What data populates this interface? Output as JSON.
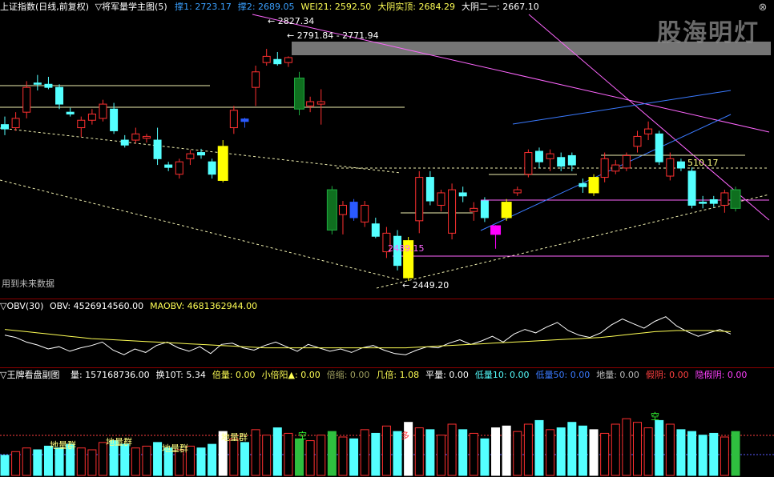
{
  "main": {
    "index_name": "上证指数(日线,前复权)",
    "indicator_name": "▽将军量学主图(5)",
    "items": [
      {
        "label": "撑1:",
        "value": "2723.17",
        "color": "#3aa0ff"
      },
      {
        "label": "撑2:",
        "value": "2689.05",
        "color": "#3aa0ff"
      },
      {
        "label": "WEI21:",
        "value": "2592.50",
        "color": "#ffff55"
      },
      {
        "label": "大阴实顶:",
        "value": "2684.29",
        "color": "#ffff55"
      },
      {
        "label": "大阴二一:",
        "value": "2667.10",
        "color": "#ffffff"
      }
    ],
    "annotations": {
      "high_label": "2827.34",
      "range_label": "2791.84 - 2771.94",
      "low_label": "2449.20",
      "mid_label": "2489.15",
      "right_label": "510.17",
      "note": "用到未来数据"
    },
    "watermark": "股海明灯"
  },
  "obv": {
    "title": "▽OBV(30)",
    "items": [
      {
        "label": "OBV:",
        "value": "4526914560.00",
        "color": "#ffffff"
      },
      {
        "label": "MAOBV:",
        "value": "4681362944.00",
        "color": "#ffff55"
      }
    ]
  },
  "volume": {
    "title": "▽王牌看盘副图",
    "items": [
      {
        "label": "量:",
        "value": "157168736.00",
        "color": "#ffffff"
      },
      {
        "label": "换10T:",
        "value": "5.34",
        "color": "#ffffff"
      },
      {
        "label": "倍量:",
        "value": "0.00",
        "color": "#ffff55"
      },
      {
        "label": "小倍阳▲:",
        "value": "0.00",
        "color": "#ffff55"
      },
      {
        "label": "倍缩:",
        "value": "0.00",
        "color": "#a0a060"
      },
      {
        "label": "几倍:",
        "value": "1.08",
        "color": "#ffff55"
      },
      {
        "label": "平量:",
        "value": "0.00",
        "color": "#ffffff"
      },
      {
        "label": "低量10:",
        "value": "0.00",
        "color": "#55ffff"
      },
      {
        "label": "低量50:",
        "value": "0.00",
        "color": "#3a7aff"
      },
      {
        "label": "地量:",
        "value": "0.00",
        "color": "#bbbbbb"
      },
      {
        "label": "假阴:",
        "value": "0.00",
        "color": "#ff4040"
      },
      {
        "label": "隐假阴:",
        "value": "0.00",
        "color": "#ff40ff"
      }
    ],
    "tags": [
      "地量群",
      "地量群",
      "地量群",
      "地量群",
      "空",
      "空",
      "多"
    ]
  },
  "chart_data": [
    {
      "type": "candlestick",
      "colors": {
        "up": "#ff3030",
        "down": "#54ffff",
        "highlight_yellow": "#ffff00",
        "highlight_magenta": "#ff00ff",
        "dark_green": "#0f6f1f",
        "blue": "#2a5aff"
      },
      "candles": [
        {
          "o": 2705,
          "h": 2718,
          "l": 2688,
          "c": 2698,
          "k": "down"
        },
        {
          "o": 2700,
          "h": 2725,
          "l": 2695,
          "c": 2715,
          "k": "up"
        },
        {
          "o": 2725,
          "h": 2775,
          "l": 2715,
          "c": 2765,
          "k": "up"
        },
        {
          "o": 2770,
          "h": 2785,
          "l": 2760,
          "c": 2772,
          "k": "down"
        },
        {
          "o": 2770,
          "h": 2782,
          "l": 2762,
          "c": 2765,
          "k": "down"
        },
        {
          "o": 2765,
          "h": 2770,
          "l": 2730,
          "c": 2738,
          "k": "down"
        },
        {
          "o": 2725,
          "h": 2732,
          "l": 2718,
          "c": 2722,
          "k": "down"
        },
        {
          "o": 2700,
          "h": 2718,
          "l": 2685,
          "c": 2712,
          "k": "up"
        },
        {
          "o": 2712,
          "h": 2730,
          "l": 2705,
          "c": 2722,
          "k": "up"
        },
        {
          "o": 2715,
          "h": 2745,
          "l": 2710,
          "c": 2738,
          "k": "up"
        },
        {
          "o": 2730,
          "h": 2740,
          "l": 2690,
          "c": 2695,
          "k": "down"
        },
        {
          "o": 2680,
          "h": 2688,
          "l": 2668,
          "c": 2672,
          "k": "down"
        },
        {
          "o": 2680,
          "h": 2700,
          "l": 2675,
          "c": 2690,
          "k": "up"
        },
        {
          "o": 2683,
          "h": 2690,
          "l": 2676,
          "c": 2686,
          "k": "up"
        },
        {
          "o": 2680,
          "h": 2700,
          "l": 2640,
          "c": 2650,
          "k": "down"
        },
        {
          "o": 2640,
          "h": 2645,
          "l": 2630,
          "c": 2636,
          "k": "down"
        },
        {
          "o": 2625,
          "h": 2650,
          "l": 2618,
          "c": 2645,
          "k": "up"
        },
        {
          "o": 2650,
          "h": 2664,
          "l": 2640,
          "c": 2658,
          "k": "up"
        },
        {
          "o": 2660,
          "h": 2666,
          "l": 2650,
          "c": 2656,
          "k": "down"
        },
        {
          "o": 2645,
          "h": 2650,
          "l": 2618,
          "c": 2625,
          "k": "down"
        },
        {
          "o": 2615,
          "h": 2680,
          "l": 2612,
          "c": 2670,
          "k": "yellow"
        },
        {
          "o": 2700,
          "h": 2735,
          "l": 2690,
          "c": 2728,
          "k": "up"
        },
        {
          "o": 2710,
          "h": 2716,
          "l": 2700,
          "c": 2714,
          "k": "blue"
        },
        {
          "o": 2765,
          "h": 2800,
          "l": 2735,
          "c": 2790,
          "k": "up"
        },
        {
          "o": 2805,
          "h": 2827,
          "l": 2800,
          "c": 2815,
          "k": "up"
        },
        {
          "o": 2810,
          "h": 2822,
          "l": 2800,
          "c": 2803,
          "k": "down"
        },
        {
          "o": 2805,
          "h": 2815,
          "l": 2798,
          "c": 2813,
          "k": "up"
        },
        {
          "o": 2780,
          "h": 2790,
          "l": 2720,
          "c": 2730,
          "k": "green"
        },
        {
          "o": 2735,
          "h": 2750,
          "l": 2725,
          "c": 2742,
          "k": "up"
        },
        {
          "o": 2742,
          "h": 2762,
          "l": 2705,
          "c": 2738,
          "k": "up"
        },
        {
          "o": 2600,
          "h": 2606,
          "l": 2528,
          "c": 2535,
          "k": "green"
        },
        {
          "o": 2560,
          "h": 2582,
          "l": 2528,
          "c": 2575,
          "k": "up"
        },
        {
          "o": 2580,
          "h": 2585,
          "l": 2550,
          "c": 2555,
          "k": "blue"
        },
        {
          "o": 2575,
          "h": 2582,
          "l": 2540,
          "c": 2548,
          "k": "up"
        },
        {
          "o": 2545,
          "h": 2555,
          "l": 2522,
          "c": 2525,
          "k": "down"
        },
        {
          "o": 2500,
          "h": 2540,
          "l": 2490,
          "c": 2530,
          "k": "up"
        },
        {
          "o": 2525,
          "h": 2535,
          "l": 2470,
          "c": 2478,
          "k": "down"
        },
        {
          "o": 2518,
          "h": 2524,
          "l": 2453,
          "c": 2458,
          "k": "yellow"
        },
        {
          "o": 2550,
          "h": 2630,
          "l": 2530,
          "c": 2620,
          "k": "up"
        },
        {
          "o": 2620,
          "h": 2630,
          "l": 2575,
          "c": 2582,
          "k": "down"
        },
        {
          "o": 2575,
          "h": 2600,
          "l": 2565,
          "c": 2595,
          "k": "up"
        },
        {
          "o": 2600,
          "h": 2610,
          "l": 2520,
          "c": 2530,
          "k": "up"
        },
        {
          "o": 2590,
          "h": 2605,
          "l": 2580,
          "c": 2595,
          "k": "down"
        },
        {
          "o": 2570,
          "h": 2580,
          "l": 2550,
          "c": 2565,
          "k": "up"
        },
        {
          "o": 2582,
          "h": 2588,
          "l": 2548,
          "c": 2555,
          "k": "down"
        },
        {
          "o": 2528,
          "h": 2543,
          "l": 2505,
          "c": 2542,
          "k": "magenta"
        },
        {
          "o": 2555,
          "h": 2585,
          "l": 2550,
          "c": 2580,
          "k": "yellow"
        },
        {
          "o": 2600,
          "h": 2605,
          "l": 2590,
          "c": 2595,
          "k": "up"
        },
        {
          "o": 2625,
          "h": 2665,
          "l": 2620,
          "c": 2660,
          "k": "up"
        },
        {
          "o": 2645,
          "h": 2668,
          "l": 2635,
          "c": 2662,
          "k": "down"
        },
        {
          "o": 2650,
          "h": 2665,
          "l": 2630,
          "c": 2658,
          "k": "up"
        },
        {
          "o": 2652,
          "h": 2660,
          "l": 2630,
          "c": 2638,
          "k": "down"
        },
        {
          "o": 2655,
          "h": 2660,
          "l": 2630,
          "c": 2640,
          "k": "down"
        },
        {
          "o": 2605,
          "h": 2618,
          "l": 2595,
          "c": 2610,
          "k": "down"
        },
        {
          "o": 2595,
          "h": 2625,
          "l": 2590,
          "c": 2620,
          "k": "yellow"
        },
        {
          "o": 2620,
          "h": 2660,
          "l": 2612,
          "c": 2650,
          "k": "up"
        },
        {
          "o": 2630,
          "h": 2648,
          "l": 2625,
          "c": 2640,
          "k": "up"
        },
        {
          "o": 2635,
          "h": 2660,
          "l": 2630,
          "c": 2655,
          "k": "up"
        },
        {
          "o": 2670,
          "h": 2695,
          "l": 2660,
          "c": 2686,
          "k": "up"
        },
        {
          "o": 2690,
          "h": 2710,
          "l": 2680,
          "c": 2698,
          "k": "up"
        },
        {
          "o": 2690,
          "h": 2695,
          "l": 2640,
          "c": 2645,
          "k": "down"
        },
        {
          "o": 2650,
          "h": 2660,
          "l": 2615,
          "c": 2622,
          "k": "up"
        },
        {
          "o": 2645,
          "h": 2650,
          "l": 2630,
          "c": 2635,
          "k": "down"
        },
        {
          "o": 2630,
          "h": 2636,
          "l": 2570,
          "c": 2575,
          "k": "down"
        },
        {
          "o": 2580,
          "h": 2590,
          "l": 2570,
          "c": 2578,
          "k": "down"
        },
        {
          "o": 2578,
          "h": 2590,
          "l": 2572,
          "c": 2584,
          "k": "down"
        },
        {
          "o": 2575,
          "h": 2600,
          "l": 2563,
          "c": 2595,
          "k": "up"
        },
        {
          "o": 2570,
          "h": 2605,
          "l": 2565,
          "c": 2600,
          "k": "green"
        }
      ],
      "price_range": [
        2435,
        2880
      ]
    },
    {
      "type": "line",
      "series": [
        {
          "name": "OBV",
          "color": "#ffffff",
          "values": [
            42,
            38,
            30,
            25,
            18,
            22,
            14,
            20,
            24,
            30,
            16,
            8,
            18,
            12,
            24,
            30,
            20,
            14,
            22,
            10,
            26,
            28,
            20,
            16,
            24,
            30,
            22,
            14,
            26,
            20,
            14,
            18,
            12,
            20,
            24,
            16,
            10,
            8,
            16,
            22,
            20,
            28,
            34,
            26,
            32,
            40,
            30,
            44,
            52,
            46,
            56,
            64,
            50,
            42,
            38,
            46,
            60,
            70,
            62,
            54,
            66,
            74,
            58,
            48,
            40,
            46,
            52,
            44
          ]
        },
        {
          "name": "MAOBV",
          "color": "#ffff55",
          "values": [
            52,
            50,
            48,
            46,
            44,
            42,
            40,
            38,
            36,
            35,
            34,
            33,
            32,
            31,
            30,
            29,
            28,
            27,
            26,
            25,
            24,
            23,
            22,
            21,
            20,
            20,
            20,
            20,
            20,
            20,
            20,
            20,
            20,
            20,
            20,
            20,
            20,
            20,
            21,
            22,
            23,
            24,
            25,
            26,
            27,
            28,
            29,
            30,
            31,
            32,
            33,
            34,
            35,
            36,
            37,
            38,
            40,
            42,
            44,
            46,
            48,
            49,
            50,
            50,
            50,
            50,
            49,
            48
          ]
        }
      ]
    },
    {
      "type": "bar",
      "values": [
        22,
        26,
        30,
        28,
        32,
        30,
        34,
        30,
        28,
        36,
        38,
        34,
        30,
        32,
        36,
        30,
        28,
        32,
        30,
        34,
        48,
        40,
        36,
        50,
        44,
        52,
        46,
        40,
        38,
        44,
        48,
        42,
        40,
        50,
        46,
        54,
        48,
        58,
        52,
        50,
        44,
        56,
        50,
        46,
        40,
        52,
        54,
        48,
        56,
        60,
        50,
        52,
        58,
        54,
        50,
        46,
        56,
        62,
        58,
        52,
        60,
        56,
        50,
        48,
        44,
        46,
        42,
        48
      ],
      "range": [
        0,
        70
      ]
    }
  ]
}
